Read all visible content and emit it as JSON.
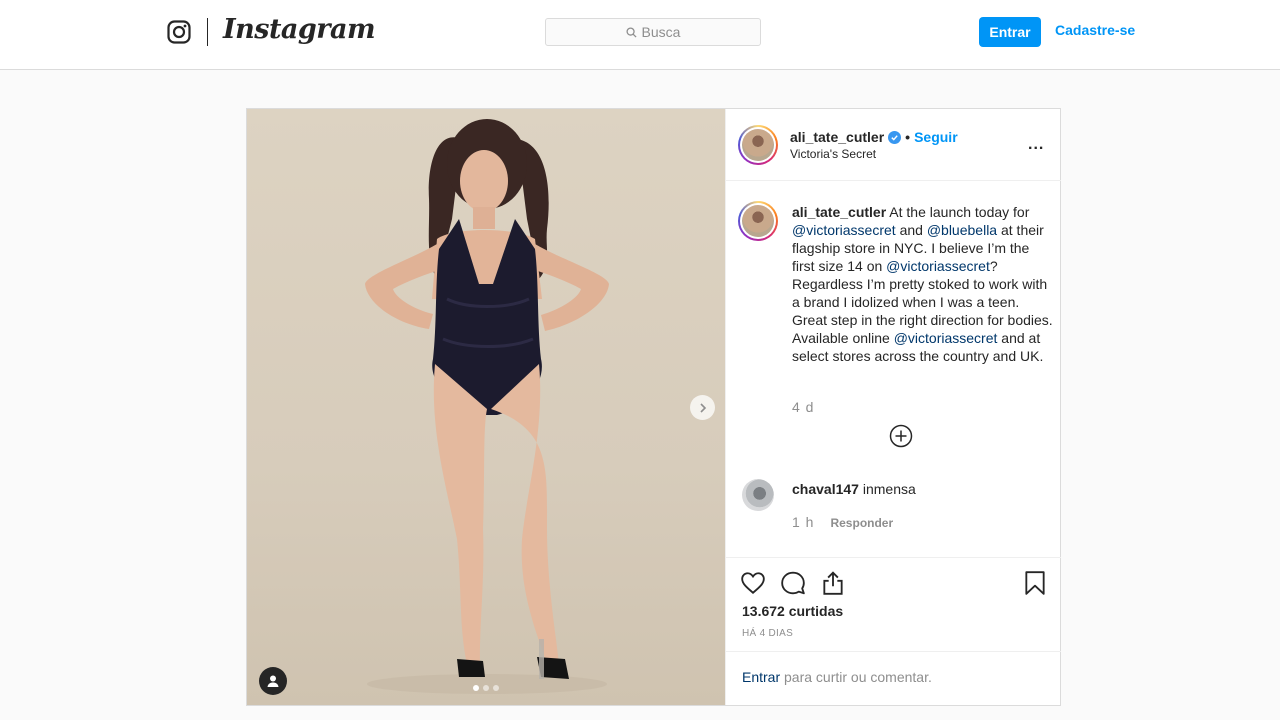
{
  "header": {
    "brand": "Instagram",
    "search_placeholder": "Busca",
    "login_label": "Entrar",
    "signup_label": "Cadastre-se"
  },
  "post": {
    "username": "ali_tate_cutler",
    "follow_label": "Seguir",
    "separator": "•",
    "location": "Victoria's Secret",
    "more_label": "...",
    "caption": {
      "username": "ali_tate_cutler",
      "parts": [
        {
          "t": "text",
          "v": " At the launch today for "
        },
        {
          "t": "mention",
          "v": "@victoriassecret"
        },
        {
          "t": "text",
          "v": " and "
        },
        {
          "t": "mention",
          "v": "@bluebella"
        },
        {
          "t": "text",
          "v": " at their flagship store in NYC. I believe I’m the first size 14 on "
        },
        {
          "t": "mention",
          "v": "@victoriassecret"
        },
        {
          "t": "text",
          "v": "? Regardless I’m pretty stoked to work with a brand I idolized when I was a teen. Great step in the right direction for bodies. Available online "
        },
        {
          "t": "mention",
          "v": "@victoriassecret"
        },
        {
          "t": "text",
          "v": " and at select stores across the country and UK."
        }
      ],
      "time": "4 d"
    },
    "comments": [
      {
        "username": "chaval147",
        "text": "inmensa",
        "time": "1 h",
        "reply_label": "Responder"
      }
    ],
    "likes": "13.672 curtidas",
    "posted_ago": "HÁ 4 DIAS",
    "login_prompt": {
      "link": "Entrar",
      "rest": " para curtir ou comentar."
    },
    "carousel": {
      "total": 3,
      "active_index": 0
    }
  },
  "colors": {
    "accent": "#0095f6",
    "text": "#262626",
    "muted": "#8e8e8e",
    "mention": "#00376b",
    "border": "#dbdbdb"
  }
}
